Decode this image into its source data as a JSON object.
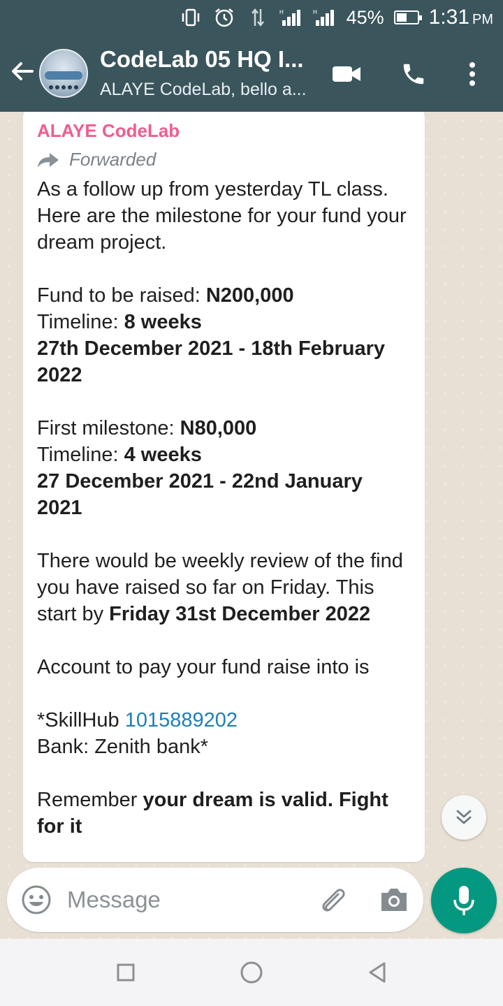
{
  "status_bar": {
    "battery": "45%",
    "time": "1:31",
    "ampm": "PM",
    "icons": [
      "vibrate-icon",
      "alarm-icon",
      "data-arrows-icon",
      "signal-icon-1",
      "signal-icon-2",
      "battery-icon"
    ]
  },
  "header": {
    "title": "CodeLab 05 HQ I...",
    "subtitle": "ALAYE  CodeLab, bello a...",
    "icons": [
      "back-arrow-icon",
      "video-call-icon",
      "voice-call-icon",
      "more-vert-icon"
    ]
  },
  "message": {
    "sender": "ALAYE  CodeLab",
    "forwarded_label": "Forwarded",
    "intro": "As a follow up from yesterday TL class. Here are the milestone  for your fund your dream project.",
    "fund_label": "Fund to be raised:  ",
    "fund_value": "N200,000",
    "timeline_label": "Timeline: ",
    "timeline_value": "8 weeks",
    "date_range": "27th December 2021 - 18th February 2022",
    "first_label": "First milestone: ",
    "first_value": "N80,000",
    "timeline2_label": "Timeline: ",
    "timeline2_value": "4 weeks",
    "date_range2": "27 December 2021 - 22nd January 2021",
    "review_text": "There would be weekly review of the find you have raised so far on Friday. This start by ",
    "review_bold": "Friday 31st December 2022",
    "account_text": "Account to pay your fund raise into is",
    "account_prefix": "*SkillHub ",
    "account_number": "1015889202",
    "bank": "Bank: Zenith bank*",
    "remember_text": "Remember ",
    "remember_bold": "your dream is valid. Fight for it"
  },
  "composer": {
    "placeholder": "Message"
  },
  "colors": {
    "header_bg": "#3b555c",
    "sender": "#f05d8d",
    "link": "#1d7fb9",
    "mic_bg": "#03987f"
  }
}
